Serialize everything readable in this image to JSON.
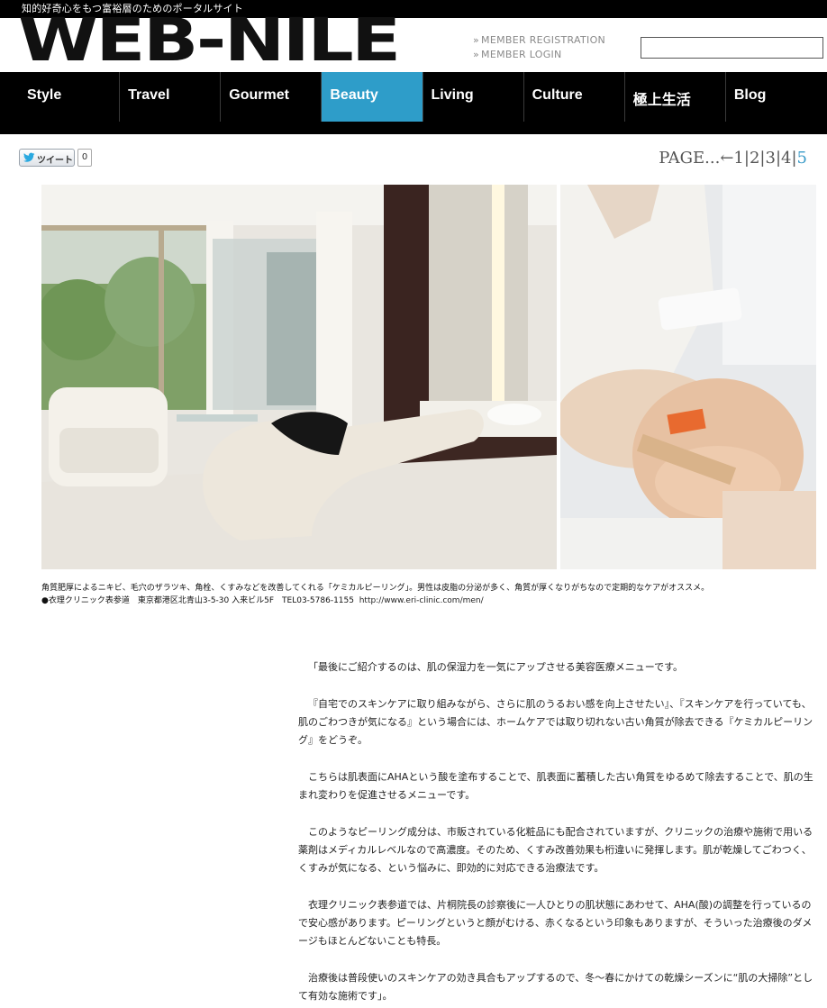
{
  "header": {
    "tagline": "知的好奇心をもつ富裕層のためのポータルサイト",
    "logo_text": "WEB-NILE",
    "member_registration": "MEMBER REGISTRATION",
    "member_login": "MEMBER LOGIN",
    "search": {
      "value": "",
      "placeholder": ""
    }
  },
  "nav": {
    "items": [
      {
        "label": "Style"
      },
      {
        "label": "Travel"
      },
      {
        "label": "Gourmet"
      },
      {
        "label": "Beauty",
        "active": true
      },
      {
        "label": "Living"
      },
      {
        "label": "Culture"
      },
      {
        "label": "極上生活"
      },
      {
        "label": "Blog"
      }
    ],
    "active_color": "#2e9dc9"
  },
  "share": {
    "tweet_label": "ツイート",
    "tweet_count": "0"
  },
  "pager": {
    "prefix": "PAGE...←",
    "pages": [
      "1",
      "2",
      "3",
      "4",
      "5"
    ],
    "current": "5",
    "current_color": "#3a9bc8"
  },
  "caption": {
    "line1": "角質肥厚によるニキビ、毛穴のザラツキ、角栓、くすみなどを改善してくれる「ケミカルピーリング」。男性は皮脂の分泌が多く、角質が厚くなりがちなので定期的なケアがオススメ。",
    "line2": "●衣理クリニック表参道　東京都港区北青山3-5-30 入来ビル5F　TEL03-5786-1155",
    "url": "http://www.eri-clinic.com/men/"
  },
  "article": {
    "paragraphs": [
      "「最後にご紹介するのは、肌の保湿力を一気にアップさせる美容医療メニューです。",
      "『自宅でのスキンケアに取り組みながら、さらに肌のうるおい感を向上させたい』、『スキンケアを行っていても、肌のごわつきが気になる』という場合には、ホームケアでは取り切れない古い角質が除去できる『ケミカルピーリング』をどうぞ。",
      "こちらは肌表面にAHAという酸を塗布することで、肌表面に蓄積した古い角質をゆるめて除去することで、肌の生まれ変わりを促進させるメニューです。",
      "このようなピーリング成分は、市販されている化粧品にも配合されていますが、クリニックの治療や施術で用いる薬剤はメディカルレベルなので高濃度。そのため、くすみ改善効果も桁違いに発揮します。肌が乾燥してごわつく、くすみが気になる、という悩みに、即効的に対応できる治療法です。",
      "衣理クリニック表参道では、片桐院長の診察後に一人ひとりの肌状態にあわせて、AHA(酸)の調整を行っているので安心感があります。ピーリングというと顔がむける、赤くなるという印象もありますが、そういった治療後のダメージもほとんどないことも特長。",
      "治療後は普段使いのスキンケアの効き具合もアップするので、冬〜春にかけての乾燥シーズンに“肌の大掃除”として有効な施術です」。"
    ]
  }
}
